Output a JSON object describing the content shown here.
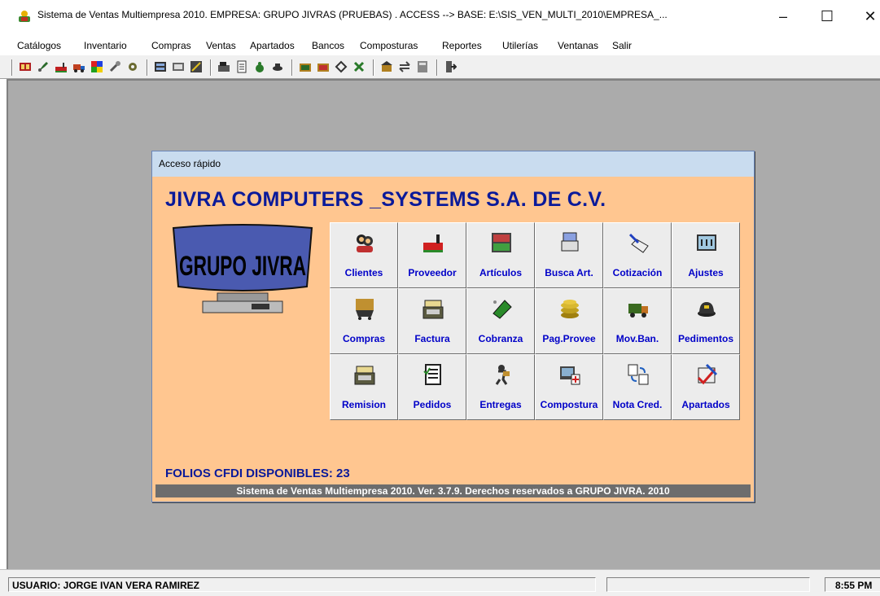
{
  "window": {
    "title": "Sistema de Ventas Multiempresa 2010. EMPRESA: GRUPO JIVRAS (PRUEBAS)   . ACCESS --> BASE: E:\\SIS_VEN_MULTI_2010\\EMPRESA_...",
    "controls": {
      "minimize": "–",
      "maximize": "☐",
      "close": "✕"
    }
  },
  "menu": [
    "Catálogos",
    "Inventario",
    "Compras",
    "Ventas",
    "Apartados",
    "Bancos",
    "Composturas",
    "Reportes",
    "Utilerías",
    "Ventanas",
    "Salir"
  ],
  "toolbar_icons": [
    "catalog-icon",
    "brush-icon",
    "factory-icon",
    "truck-icon",
    "color-palette-icon",
    "tools-icon",
    "gear-icon",
    "inventory-icon",
    "report-icon",
    "adjust-icon",
    "cash-register-icon",
    "receipt-icon",
    "money-bag-icon",
    "pedimento-icon",
    "folder-icon",
    "folder-open-icon",
    "tag-icon",
    "gift-icon",
    "bank-icon",
    "exchange-icon",
    "calculator-icon",
    "exit-icon"
  ],
  "panel": {
    "title": "Acceso rápido",
    "company": "JIVRA COMPUTERS _SYSTEMS S.A. DE C.V.",
    "logo_text": "GRUPO JIVRA",
    "buttons": [
      [
        {
          "label": "Clientes",
          "icon": "clients-icon"
        },
        {
          "label": "Proveedor",
          "icon": "factory-icon"
        },
        {
          "label": "Artículos",
          "icon": "shelf-icon"
        },
        {
          "label": "Busca Art.",
          "icon": "search-articles-icon"
        },
        {
          "label": "Cotización",
          "icon": "quote-icon"
        },
        {
          "label": "Ajustes",
          "icon": "adjust-icon"
        }
      ],
      [
        {
          "label": "Compras",
          "icon": "cart-icon"
        },
        {
          "label": "Factura",
          "icon": "cash-register-icon"
        },
        {
          "label": "Cobranza",
          "icon": "money-icon"
        },
        {
          "label": "Pag.Provee",
          "icon": "coins-icon"
        },
        {
          "label": "Mov.Ban.",
          "icon": "armored-truck-icon"
        },
        {
          "label": "Pedimentos",
          "icon": "customs-cap-icon"
        }
      ],
      [
        {
          "label": "Remision",
          "icon": "cash-register-icon"
        },
        {
          "label": "Pedidos",
          "icon": "checklist-icon"
        },
        {
          "label": "Entregas",
          "icon": "delivery-icon"
        },
        {
          "label": "Compostura",
          "icon": "repair-icon"
        },
        {
          "label": "Nota Cred.",
          "icon": "credit-note-icon"
        },
        {
          "label": "Apartados",
          "icon": "reserve-icon"
        }
      ]
    ],
    "folios": "FOLIOS CFDI DISPONIBLES: 23",
    "footer": "Sistema de Ventas Multiempresa 2010. Ver. 3.7.9.  Derechos reservados a GRUPO JIVRA. 2010"
  },
  "status": {
    "user": "USUARIO: JORGE IVAN VERA RAMIREZ",
    "time": "8:55 PM"
  },
  "colors": {
    "panel_bg": "#ffc690",
    "title_blue": "#0a1a9a",
    "button_label": "#0000c8",
    "desktop": "#ababab"
  }
}
